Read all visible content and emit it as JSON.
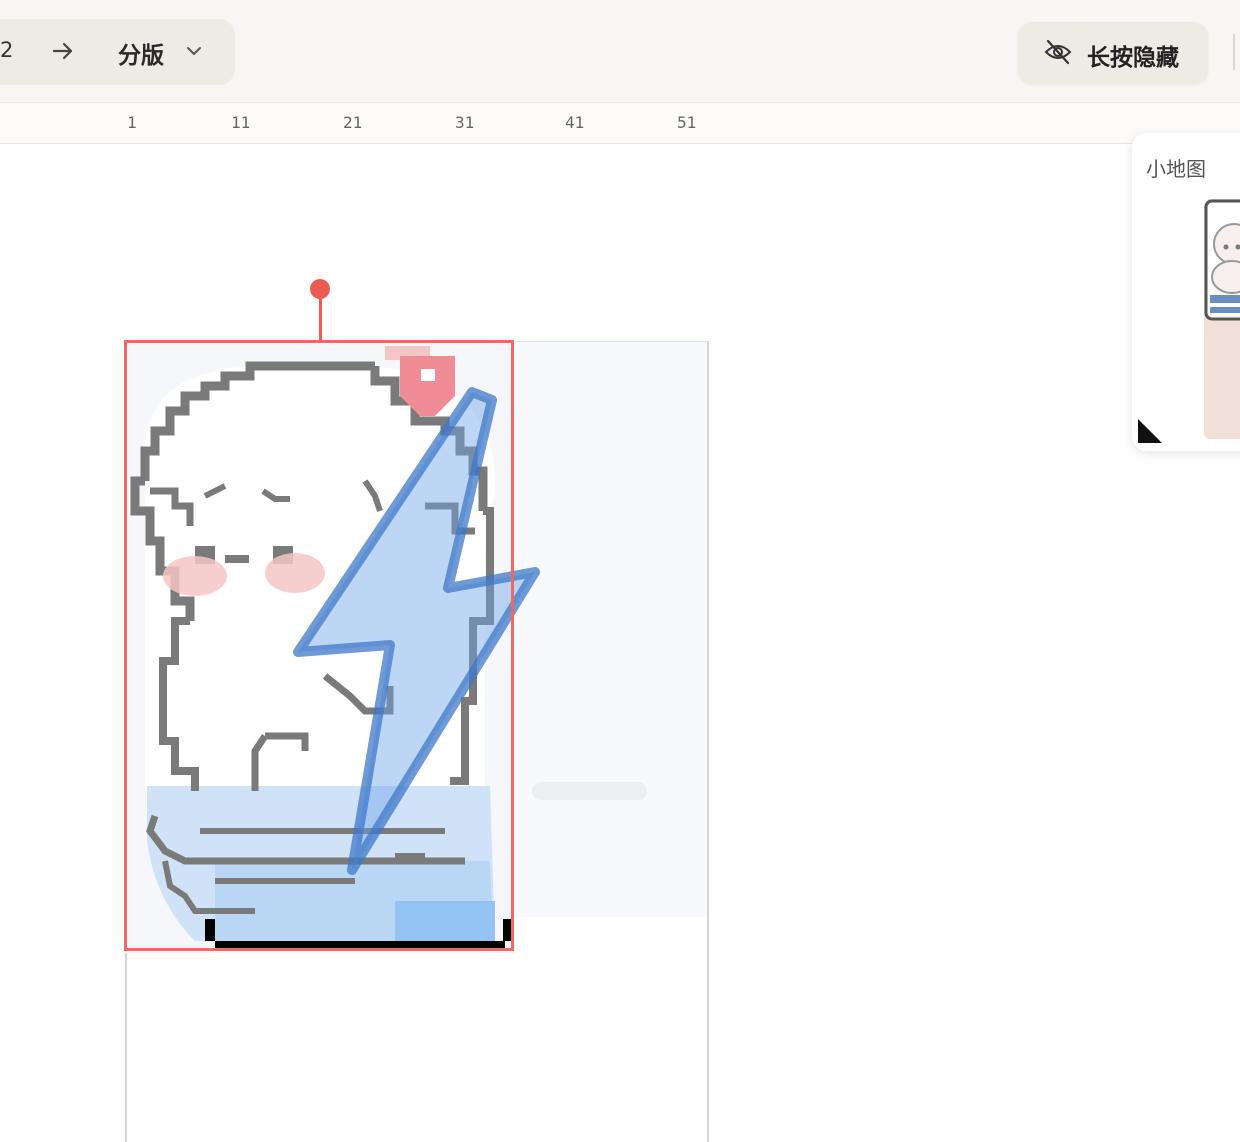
{
  "toolbar": {
    "page_number": "2",
    "split_label": "分版",
    "hide_label": "长按隐藏",
    "icons": {
      "next": "arrow-right-icon",
      "dropdown": "chevron-down-icon",
      "hide": "eye-off-icon"
    }
  },
  "ruler": {
    "ticks": [
      "1",
      "11",
      "21",
      "31",
      "41",
      "51"
    ]
  },
  "minimap": {
    "title": "小地图"
  },
  "colors": {
    "accent": "#ee5b52",
    "pixel_outline": "#7a7a7a",
    "pixel_blue": "#b9d6f5",
    "lightning": "#4f87d6",
    "cheek": "#f6c6c6"
  }
}
